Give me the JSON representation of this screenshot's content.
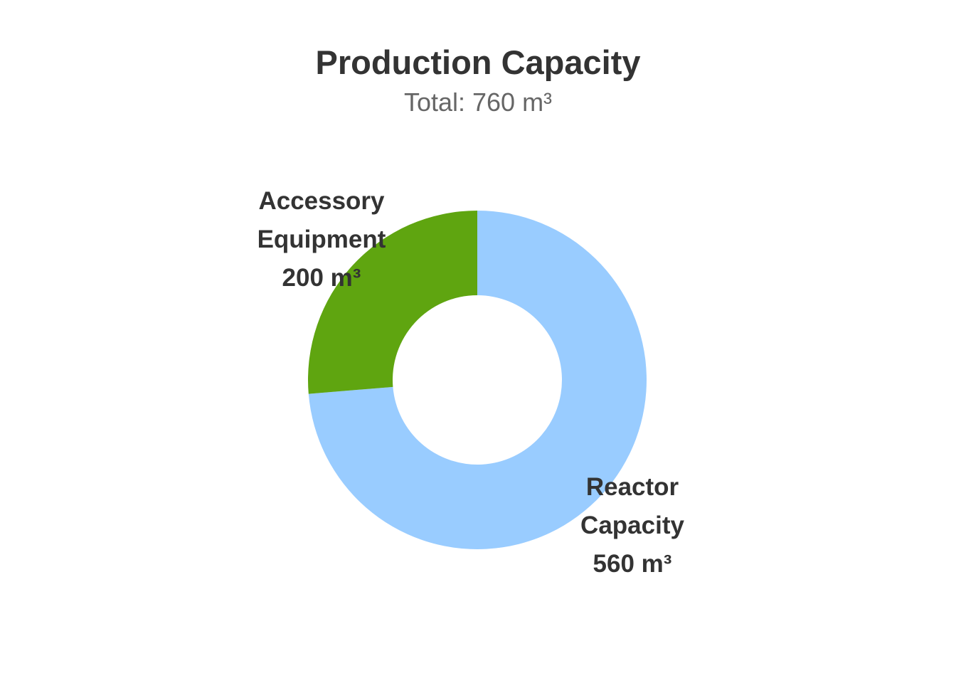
{
  "chart_data": {
    "type": "pie",
    "style": "donut",
    "title": "Production Capacity",
    "subtitle": "Total: 760 m³",
    "unit": "m³",
    "slices": [
      {
        "name": "Reactor Capacity",
        "label_lines": [
          "Reactor",
          "Capacity",
          "560 m³"
        ],
        "value": 560,
        "color": "#99CCFF"
      },
      {
        "name": "Accessory Equipment",
        "label_lines": [
          "Accessory",
          "Equipment",
          "200 m³"
        ],
        "value": 200,
        "color": "#5FA510"
      }
    ],
    "label_color": "#333333",
    "legend": "none"
  }
}
